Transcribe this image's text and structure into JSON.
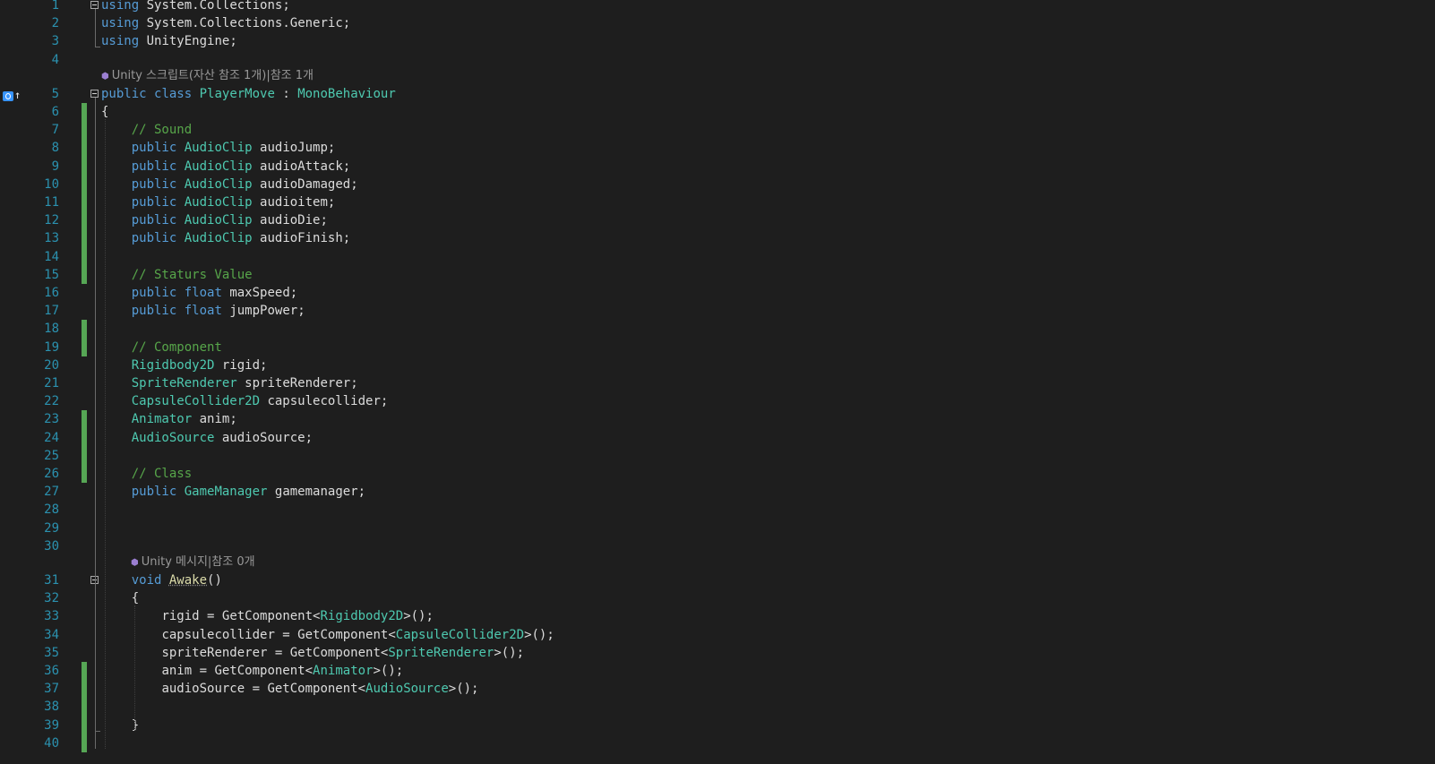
{
  "gutter_markers": {
    "line5_icon": "override-bookmark-icon",
    "line5_arrow": "↑"
  },
  "lines": [
    {
      "n": "1",
      "t": "using System.Collections;"
    },
    {
      "n": "2",
      "t": "using System.Collections.Generic;"
    },
    {
      "n": "3",
      "t": "using UnityEngine;"
    },
    {
      "n": "4",
      "t": ""
    },
    {
      "n": "5",
      "t": "public class PlayerMove : MonoBehaviour"
    },
    {
      "n": "6",
      "t": "{"
    },
    {
      "n": "7",
      "t": "    // Sound"
    },
    {
      "n": "8",
      "t": "    public AudioClip audioJump;"
    },
    {
      "n": "9",
      "t": "    public AudioClip audioAttack;"
    },
    {
      "n": "10",
      "t": "    public AudioClip audioDamaged;"
    },
    {
      "n": "11",
      "t": "    public AudioClip audioitem;"
    },
    {
      "n": "12",
      "t": "    public AudioClip audioDie;"
    },
    {
      "n": "13",
      "t": "    public AudioClip audioFinish;"
    },
    {
      "n": "14",
      "t": ""
    },
    {
      "n": "15",
      "t": "    // Staturs Value"
    },
    {
      "n": "16",
      "t": "    public float maxSpeed;"
    },
    {
      "n": "17",
      "t": "    public float jumpPower;"
    },
    {
      "n": "18",
      "t": ""
    },
    {
      "n": "19",
      "t": "    // Component"
    },
    {
      "n": "20",
      "t": "    Rigidbody2D rigid;"
    },
    {
      "n": "21",
      "t": "    SpriteRenderer spriteRenderer;"
    },
    {
      "n": "22",
      "t": "    CapsuleCollider2D capsulecollider;"
    },
    {
      "n": "23",
      "t": "    Animator anim;"
    },
    {
      "n": "24",
      "t": "    AudioSource audioSource;"
    },
    {
      "n": "25",
      "t": ""
    },
    {
      "n": "26",
      "t": "    // Class"
    },
    {
      "n": "27",
      "t": "    public GameManager gamemanager;"
    },
    {
      "n": "28",
      "t": ""
    },
    {
      "n": "29",
      "t": ""
    },
    {
      "n": "30",
      "t": ""
    },
    {
      "n": "31",
      "t": "    void Awake()"
    },
    {
      "n": "32",
      "t": "    {"
    },
    {
      "n": "33",
      "t": "        rigid = GetComponent<Rigidbody2D>();"
    },
    {
      "n": "34",
      "t": "        capsulecollider = GetComponent<CapsuleCollider2D>();"
    },
    {
      "n": "35",
      "t": "        spriteRenderer = GetComponent<SpriteRenderer>();"
    },
    {
      "n": "36",
      "t": "        anim = GetComponent<Animator>();"
    },
    {
      "n": "37",
      "t": "        audioSource = GetComponent<AudioSource>();"
    },
    {
      "n": "38",
      "t": ""
    },
    {
      "n": "39",
      "t": "    }"
    },
    {
      "n": "40",
      "t": ""
    }
  ],
  "codelens": [
    {
      "before_line": "5",
      "text": "Unity 스크립트(자산 참조 1개)|참조 1개"
    },
    {
      "before_line": "31",
      "text": "Unity 메시지|참조 0개"
    }
  ],
  "colors": {
    "background": "#1e1e1e",
    "line_number": "#2b91af",
    "keyword": "#569cd6",
    "type": "#4ec9b0",
    "comment": "#57a64a",
    "text": "#dcdcdc",
    "codelens": "#999999",
    "change_bar": "#56a655"
  }
}
